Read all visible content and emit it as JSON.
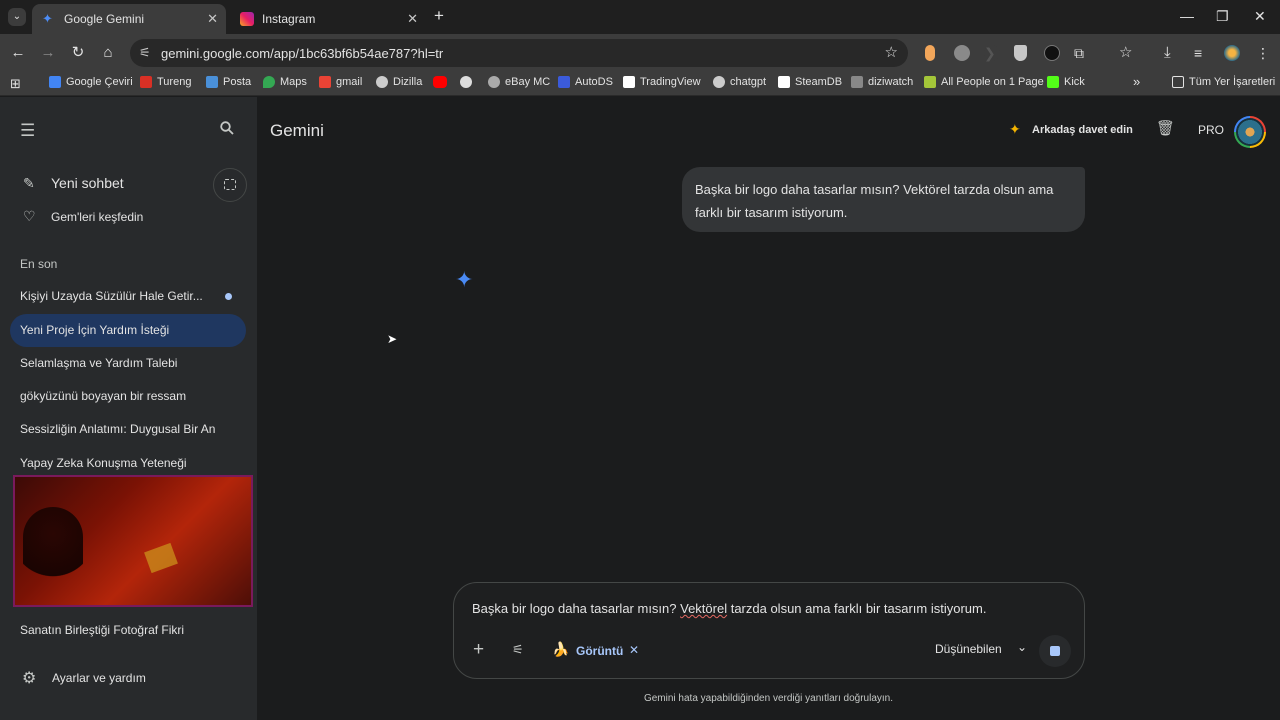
{
  "browser": {
    "tabs": [
      {
        "title": "Google Gemini",
        "active": true,
        "icon": "gemini-icon"
      },
      {
        "title": "Instagram",
        "active": false,
        "icon": "instagram-icon"
      }
    ],
    "url": "gemini.google.com/app/1bc63bf6b54ae787?hl=tr",
    "bookmarks": [
      {
        "label": "Google Çeviri",
        "color": "#4285f4"
      },
      {
        "label": "Tureng",
        "color": "#d93025"
      },
      {
        "label": "Posta",
        "color": "#4a90d9"
      },
      {
        "label": "Maps",
        "color": "#34a853"
      },
      {
        "label": "gmail",
        "color": "#ea4335"
      },
      {
        "label": "Dizilla",
        "color": "#cccccc"
      },
      {
        "label": "",
        "color": "#ff0000"
      },
      {
        "label": "",
        "color": "#dddddd"
      },
      {
        "label": "eBay MC",
        "color": "#aaaaaa"
      },
      {
        "label": "AutoDS",
        "color": "#3b5bdb"
      },
      {
        "label": "TradingView",
        "color": "#ffffff"
      },
      {
        "label": "chatgpt",
        "color": "#cccccc"
      },
      {
        "label": "SteamDB",
        "color": "#ffffff"
      },
      {
        "label": "diziwatch",
        "color": "#888888"
      },
      {
        "label": "All People on 1 Page",
        "color": "#a4c639"
      },
      {
        "label": "Kick",
        "color": "#53fc18"
      }
    ],
    "all_bookmarks_label": "Tüm Yer İşaretleri",
    "overflow_label": "»"
  },
  "sidebar": {
    "new_chat": "Yeni sohbet",
    "explore_gems": "Gem'leri keşfedin",
    "recent_header": "En son",
    "recent": [
      {
        "label": "Kişiyi Uzayda Süzülür Hale Getir...",
        "active": false,
        "unread": true
      },
      {
        "label": "Yeni Proje İçin Yardım İsteği",
        "active": true,
        "unread": false
      },
      {
        "label": "Selamlaşma ve Yardım Talebi",
        "active": false,
        "unread": false
      },
      {
        "label": "gökyüzünü boyayan bir ressam",
        "active": false,
        "unread": false
      },
      {
        "label": "Sessizliğin Anlatımı: Duygusal Bir An",
        "active": false,
        "unread": false
      },
      {
        "label": "Yapay Zeka Konuşma Yeteneği",
        "active": false,
        "unread": false
      },
      {
        "label": "Sanatın Birleştiği Fotoğraf Fikri",
        "active": false,
        "unread": false
      }
    ],
    "settings": "Ayarlar ve yardım"
  },
  "header": {
    "title": "Gemini",
    "invite": "Arkadaş davet edin",
    "plan_badge": "PRO"
  },
  "conversation": {
    "user_message": "Başka bir logo daha tasarlar mısın? Vektörel tarzda olsun ama farklı bir tasarım istiyorum."
  },
  "composer": {
    "text_before": "Başka bir logo daha tasarlar mısın? ",
    "text_misspelled": "Vektörel",
    "text_after": " tarzda olsun ama farklı bir tasarım istiyorum.",
    "tool_chip": "Görüntü",
    "mode": "Düşünebilen"
  },
  "footer": {
    "disclaimer": "Gemini hata yapabildiğinden verdiği yanıtları doğrulayın."
  },
  "colors": {
    "accent": "#a8c7fa",
    "sidebar_bg": "#282a2c",
    "main_bg": "#1b1c1d",
    "active_item": "#1f3760"
  }
}
